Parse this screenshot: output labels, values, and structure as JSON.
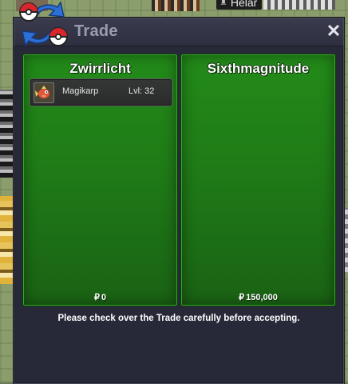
{
  "window": {
    "title": "Trade",
    "close_label": "✕",
    "footer_message": "Please check over the Trade carefully before accepting."
  },
  "player_tag": {
    "name": "Helar"
  },
  "trade": {
    "left": {
      "player_name": "Zwirrlicht",
      "items": [
        {
          "name": "Magikarp",
          "level": "Lvl: 32",
          "icon": "magikarp-icon"
        }
      ],
      "money_symbol": "₽",
      "money": "0"
    },
    "right": {
      "player_name": "Sixthmagnitude",
      "items": [],
      "money_symbol": "₽",
      "money": "150,000"
    }
  },
  "colors": {
    "panel_green": "#238b19",
    "window_bg": "#272838",
    "title_text": "#9c9cb0"
  }
}
